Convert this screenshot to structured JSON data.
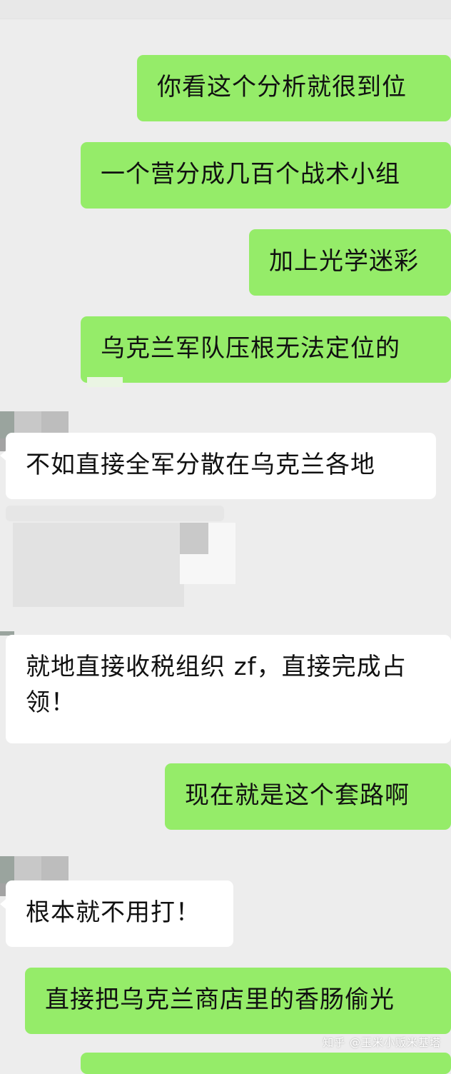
{
  "colors": {
    "background": "#ededed",
    "outgoing_bubble": "#95ec69",
    "incoming_bubble": "#ffffff",
    "text": "#111111"
  },
  "messages": [
    {
      "side": "out",
      "text": "你看这个分析就很到位"
    },
    {
      "side": "out",
      "text": "一个营分成几百个战术小组"
    },
    {
      "side": "out",
      "text": "加上光学迷彩"
    },
    {
      "side": "out",
      "text": "乌克兰军队压根无法定位的"
    },
    {
      "side": "in",
      "text": "不如直接全军分散在乌克兰各地"
    },
    {
      "side": "in",
      "text": "就地直接收税组织 zf，直接完成占领！"
    },
    {
      "side": "out",
      "text": "现在就是这个套路啊"
    },
    {
      "side": "in",
      "text": "根本就不用打！"
    },
    {
      "side": "out",
      "text": "直接把乌克兰商店里的香肠偷光"
    }
  ],
  "watermark": "知乎 @玉米小贩米基塔"
}
